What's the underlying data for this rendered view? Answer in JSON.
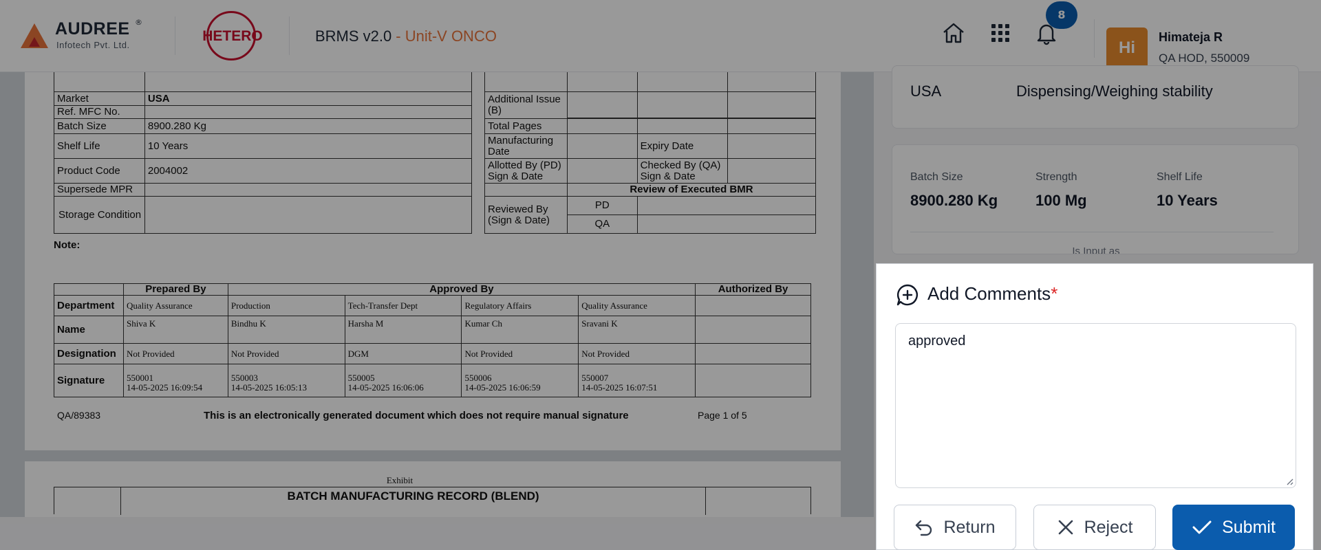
{
  "header": {
    "brand_name": "AUDREE",
    "brand_reg": "®",
    "brand_sub": "Infotech Pvt. Ltd.",
    "client_logo": "HETERO",
    "app_title": "BRMS v2.0",
    "unit": "- Unit-V ONCO",
    "notification_count": "8",
    "icons": [
      "home-icon",
      "apps-grid-icon",
      "bell-icon"
    ]
  },
  "user": {
    "initials": "Hi",
    "name": "Himateja R",
    "role": "QA HOD, 550009"
  },
  "document": {
    "left_table": [
      {
        "label": "Market",
        "value": "USA"
      },
      {
        "label": "Ref. MFC No.",
        "value": ""
      },
      {
        "label": "Batch Size",
        "value": "8900.280 Kg"
      },
      {
        "label": "Shelf Life",
        "value": "10 Years"
      },
      {
        "label": "Product Code",
        "value": "2004002"
      },
      {
        "label": "Supersede MPR",
        "value": ""
      },
      {
        "label": "Storage Condition",
        "value": ""
      }
    ],
    "right_table": {
      "additional_issue": "Additional Issue (B)",
      "total_pages": "Total Pages",
      "manufacturing_date": "Manufacturing Date",
      "expiry_date": "Expiry Date",
      "allotted_by": "Allotted By (PD) Sign & Date",
      "checked_by": "Checked By (QA) Sign & Date",
      "review_header": "Review of Executed BMR",
      "reviewed_by": "Reviewed By (Sign & Date)",
      "pd": "PD",
      "qa": "QA"
    },
    "note_label": "Note:",
    "approval": {
      "prepared_by": "Prepared By",
      "approved_by": "Approved By",
      "authorized_by": "Authorized By",
      "row_labels": [
        "Department",
        "Name",
        "Designation",
        "Signature"
      ],
      "columns": [
        {
          "department": "Quality Assurance",
          "name": "Shiva  K",
          "designation": "Not Provided",
          "sig_id": "550001",
          "sig_time": "14-05-2025 16:09:54"
        },
        {
          "department": "Production",
          "name": "Bindhu  K",
          "designation": "Not Provided",
          "sig_id": "550003",
          "sig_time": "14-05-2025 16:05:13"
        },
        {
          "department": "Tech-Transfer Dept",
          "name": "Harsha  M",
          "designation": "DGM",
          "sig_id": "550005",
          "sig_time": "14-05-2025 16:06:06"
        },
        {
          "department": "Regulatory Affairs",
          "name": "Kumar  Ch",
          "designation": "Not Provided",
          "sig_id": "550006",
          "sig_time": "14-05-2025 16:06:59"
        },
        {
          "department": "Quality Assurance",
          "name": "Sravani  K",
          "designation": "Not Provided",
          "sig_id": "550007",
          "sig_time": "14-05-2025 16:07:51"
        }
      ]
    },
    "footer": {
      "doc_no": "QA/89383",
      "statement": "This is an electronically generated document which does not require manual signature",
      "page": "Page 1 of 5"
    },
    "page2": {
      "exhibit": "Exhibit",
      "heading": "BATCH MANUFACTURING RECORD (BLEND)"
    }
  },
  "details": {
    "market": "USA",
    "stage": "Dispensing/Weighing stability",
    "batch_size_label": "Batch Size",
    "batch_size": "8900.280 Kg",
    "strength_label": "Strength",
    "strength": "100 Mg",
    "shelf_life_label": "Shelf Life",
    "shelf_life": "10 Years",
    "more_label": "Is Input as"
  },
  "comments": {
    "title": "Add Comments",
    "required_mark": "*",
    "value": "approved",
    "return_label": "Return",
    "reject_label": "Reject",
    "submit_label": "Submit"
  }
}
